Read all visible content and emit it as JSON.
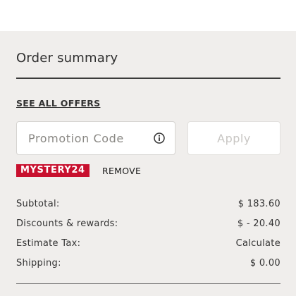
{
  "order_summary": {
    "title": "Order summary",
    "offers_link": "SEE ALL OFFERS",
    "promo": {
      "placeholder": "Promotion Code",
      "value": "",
      "info_icon": "info-circle-icon",
      "apply_label": "Apply"
    },
    "applied_code": {
      "code": "MYSTERY24",
      "remove_label": "REMOVE",
      "color": "#c8102e"
    },
    "lines": [
      {
        "label": "Subtotal:",
        "value": "$ 183.60"
      },
      {
        "label": "Discounts & rewards:",
        "value": "$ - 20.40"
      },
      {
        "label": "Estimate Tax:",
        "value": "Calculate"
      },
      {
        "label": "Shipping:",
        "value": "$ 0.00"
      }
    ]
  }
}
